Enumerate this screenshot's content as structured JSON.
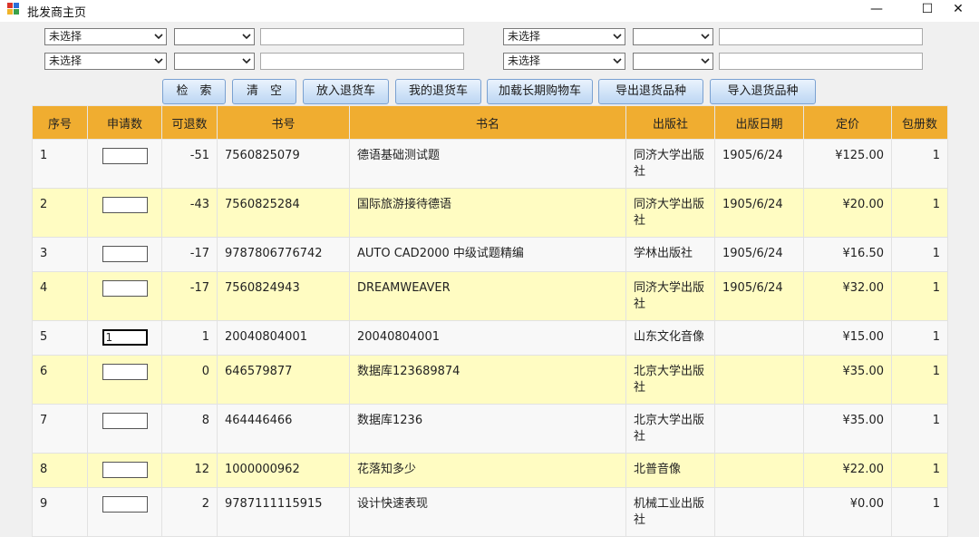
{
  "window": {
    "title": "批发商主页",
    "minimize_glyph": "—",
    "maximize_glyph": "☐",
    "close_glyph": "✕"
  },
  "filters": {
    "row1": {
      "left_field": "未选择",
      "left_op": "",
      "left_value": "",
      "right_field": "未选择",
      "right_op": "",
      "right_value": ""
    },
    "row2": {
      "left_field": "未选择",
      "left_op": "",
      "left_value": "",
      "right_field": "未选择",
      "right_op": "",
      "right_value": ""
    }
  },
  "toolbar": {
    "search": "检　索",
    "clear": "清　空",
    "add_to_return_cart": "放入退货车",
    "my_return_cart": "我的退货车",
    "load_long_term_cart": "加载长期购物车",
    "export_return_items": "导出退货品种",
    "import_return_items": "导入退货品种"
  },
  "table": {
    "headers": {
      "seq": "序号",
      "apply_qty": "申请数",
      "returnable": "可退数",
      "isbn": "书号",
      "book_name": "书名",
      "publisher": "出版社",
      "pub_date": "出版日期",
      "price": "定价",
      "pack_qty": "包册数"
    },
    "rows": [
      {
        "seq": "1",
        "apply_qty": "",
        "returnable": "-51",
        "isbn": "7560825079",
        "book_name": "德语基础测试题",
        "publisher": "同济大学出版社",
        "pub_date": "1905/6/24",
        "price": "¥125.00",
        "pack_qty": "1"
      },
      {
        "seq": "2",
        "apply_qty": "",
        "returnable": "-43",
        "isbn": "7560825284",
        "book_name": "国际旅游接待德语",
        "publisher": "同济大学出版社",
        "pub_date": "1905/6/24",
        "price": "¥20.00",
        "pack_qty": "1"
      },
      {
        "seq": "3",
        "apply_qty": "",
        "returnable": "-17",
        "isbn": "9787806776742",
        "book_name": "AUTO CAD2000 中级试题精编",
        "publisher": "学林出版社",
        "pub_date": "1905/6/24",
        "price": "¥16.50",
        "pack_qty": "1"
      },
      {
        "seq": "4",
        "apply_qty": "",
        "returnable": "-17",
        "isbn": "7560824943",
        "book_name": "DREAMWEAVER",
        "publisher": "同济大学出版社",
        "pub_date": "1905/6/24",
        "price": "¥32.00",
        "pack_qty": "1"
      },
      {
        "seq": "5",
        "apply_qty": "1",
        "returnable": "1",
        "isbn": "20040804001",
        "book_name": "20040804001",
        "publisher": "山东文化音像",
        "pub_date": "",
        "price": "¥15.00",
        "pack_qty": "1"
      },
      {
        "seq": "6",
        "apply_qty": "",
        "returnable": "0",
        "isbn": "646579877",
        "book_name": "数据库123689874",
        "publisher": "北京大学出版社",
        "pub_date": "",
        "price": "¥35.00",
        "pack_qty": "1"
      },
      {
        "seq": "7",
        "apply_qty": "",
        "returnable": "8",
        "isbn": "464446466",
        "book_name": "数据库1236",
        "publisher": "北京大学出版社",
        "pub_date": "",
        "price": "¥35.00",
        "pack_qty": "1"
      },
      {
        "seq": "8",
        "apply_qty": "",
        "returnable": "12",
        "isbn": "1000000962",
        "book_name": "花落知多少",
        "publisher": "北普音像",
        "pub_date": "",
        "price": "¥22.00",
        "pack_qty": "1"
      },
      {
        "seq": "9",
        "apply_qty": "",
        "returnable": "2",
        "isbn": "9787111115915",
        "book_name": "设计快速表现",
        "publisher": "机械工业出版社",
        "pub_date": "",
        "price": "¥0.00",
        "pack_qty": "1"
      }
    ]
  },
  "colors": {
    "header_bg": "#f0ad30",
    "row_odd_bg": "#f8f8f8",
    "row_even_bg": "#fffcc2",
    "button_gradient_top": "#eaf3fd",
    "button_gradient_bottom": "#bcd6f3"
  }
}
